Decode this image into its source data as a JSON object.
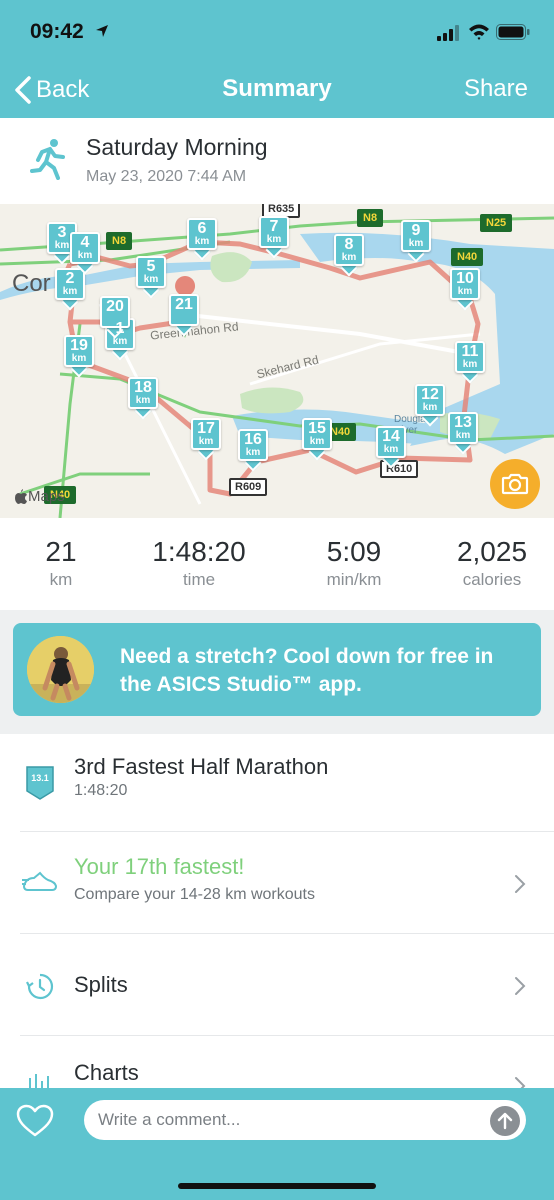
{
  "status_bar": {
    "time": "09:42"
  },
  "nav": {
    "back_label": "Back",
    "title": "Summary",
    "share_label": "Share"
  },
  "activity": {
    "title": "Saturday Morning",
    "date": "May 23, 2020 7:44 AM",
    "icon": "runner-icon"
  },
  "map": {
    "km_markers": [
      "1",
      "2",
      "3",
      "4",
      "5",
      "6",
      "7",
      "8",
      "9",
      "10",
      "11",
      "12",
      "13",
      "14",
      "15",
      "16",
      "17",
      "18",
      "19",
      "20",
      "21"
    ],
    "km_unit": "km",
    "road_labels": [
      "R635",
      "N8",
      "N8",
      "N25",
      "N40",
      "N40",
      "R609",
      "R610",
      "N40"
    ],
    "place_labels": {
      "city": "Cor",
      "road1": "Skehard Rd",
      "road2": "Greenmahon Rd",
      "place": "Douglas River"
    },
    "attribution": "Maps",
    "colors": {
      "route": "#e4877a",
      "water": "#a9d7ee",
      "park": "#cbe6c0",
      "motorway": "#7fd07c"
    }
  },
  "stats": [
    {
      "value": "21",
      "label": "km"
    },
    {
      "value": "1:48:20",
      "label": "time"
    },
    {
      "value": "5:09",
      "label": "min/km"
    },
    {
      "value": "2,025",
      "label": "calories"
    }
  ],
  "promo": {
    "text": "Need a stretch? Cool down for free in the ASICS Studio™ app."
  },
  "achievements": {
    "badge_text": "13.1",
    "title": "3rd Fastest Half Marathon",
    "subtitle": "1:48:20"
  },
  "comparison": {
    "title": "Your 17th fastest!",
    "subtitle": "Compare your 14-28 km workouts",
    "title_color": "#7fd07c"
  },
  "splits_label": "Splits",
  "charts_label": "Charts",
  "comment": {
    "placeholder": "Write a comment..."
  },
  "brand_color": "#5ec4cf"
}
